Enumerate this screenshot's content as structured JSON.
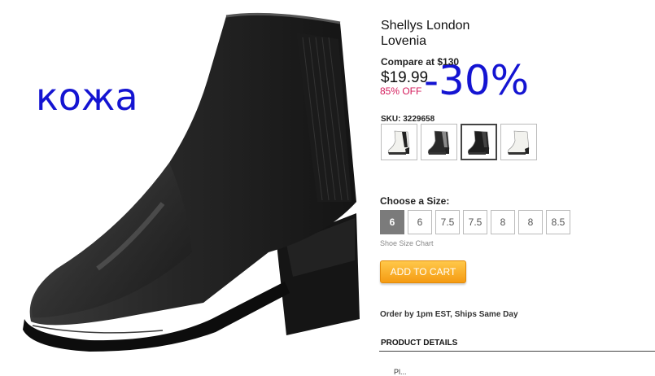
{
  "overlays": {
    "material": "кожа",
    "discount": "-30%"
  },
  "product": {
    "brand": "Shellys London",
    "name": "Lovenia",
    "compare_label": "Compare at $130",
    "price": "$19.99",
    "off": "85% OFF",
    "sku": "SKU: 3229658"
  },
  "swatches": [
    {
      "name": "swatch-white-black",
      "shaft": "#f2f2ee",
      "panel": "#222222",
      "selected": false
    },
    {
      "name": "swatch-black-gray",
      "shaft": "#2a2a2a",
      "panel": "#8a8a8a",
      "selected": false
    },
    {
      "name": "swatch-black",
      "shaft": "#1e1e1e",
      "panel": "#444444",
      "selected": true
    },
    {
      "name": "swatch-white",
      "shaft": "#f2f2ee",
      "panel": "#f2f2ee",
      "selected": false
    }
  ],
  "sizes": {
    "label": "Choose a Size:",
    "options": [
      "6",
      "6",
      "7.5",
      "7.5",
      "8",
      "8",
      "8.5"
    ],
    "selected_index": 0,
    "chart_link": "Shoe Size Chart"
  },
  "cart": {
    "label": "ADD TO CART"
  },
  "shipping": "Order by 1pm EST, Ships Same Day",
  "details": {
    "title": "PRODUCT DETAILS",
    "next": "Pl..."
  }
}
